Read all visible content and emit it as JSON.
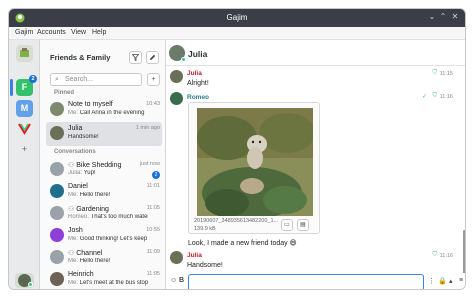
{
  "window": {
    "title": "Gajim"
  },
  "menu": [
    "Gajim",
    "Accounts",
    "View",
    "Help"
  ],
  "accounts": [
    {
      "letter": "F",
      "color": "#33c26b",
      "badge": "2"
    },
    {
      "letter": "M",
      "color": "#62a0ea",
      "badge": ""
    },
    {
      "letter": "V",
      "color": "#ffffff",
      "badge": ""
    }
  ],
  "sidebar": {
    "title": "Friends & Family",
    "search_placeholder": "Search...",
    "pinned_label": "Pinned",
    "conversations_label": "Conversations",
    "pinned": [
      {
        "name": "Note to myself",
        "who": "Me:",
        "preview": "Call Anna in the evening",
        "time": "10:43",
        "count": "",
        "color": "#7d8a6e"
      },
      {
        "name": "Julia",
        "who": "",
        "preview": "Handsome!",
        "time": "1 min ago",
        "count": "",
        "color": "#6a6f58"
      }
    ],
    "conversations": [
      {
        "name": "Bike Shedding",
        "who": "Julia:",
        "preview": "Yup!",
        "time": "just now",
        "count": "2",
        "color": "#9aa1a8",
        "group": true
      },
      {
        "name": "Daniel",
        "who": "Me:",
        "preview": "Hello there!",
        "time": "11:01",
        "count": "",
        "color": "#1f6f8b",
        "group": false
      },
      {
        "name": "Gardening",
        "who": "Romeo:",
        "preview": "That's too much water",
        "time": "11:05",
        "count": "",
        "color": "#9aa1a8",
        "group": true
      },
      {
        "name": "Josh",
        "who": "Me:",
        "preview": "Good thinking! Let's keep it",
        "time": "10:55",
        "count": "",
        "color": "#8d3fd6",
        "group": false
      },
      {
        "name": "Channel",
        "who": "Me:",
        "preview": "Hello there!",
        "time": "11:09",
        "count": "",
        "color": "#9aa1a8",
        "group": true
      },
      {
        "name": "Heinrich",
        "who": "Me:",
        "preview": "Let's meet at the bus stop tomorrow",
        "time": "11:05",
        "count": "",
        "color": "#6e6256",
        "group": false
      }
    ]
  },
  "chat": {
    "contact": "Julia",
    "messages": [
      {
        "sender": "Julia",
        "color": "#c01c28",
        "text": "Alright!",
        "time": "11:15"
      },
      {
        "sender": "Romeo",
        "color": "#2a7d8c",
        "text": "",
        "time": "11:16"
      },
      {
        "sender": "",
        "color": "",
        "text": "Look, I made a new friend today 😄",
        "time": ""
      },
      {
        "sender": "Julia",
        "color": "#c01c28",
        "text": "Handsome!",
        "time": "11:16"
      }
    ],
    "file": {
      "name": "20190607_348935613482200_1...",
      "size": "139.9 kB"
    }
  }
}
